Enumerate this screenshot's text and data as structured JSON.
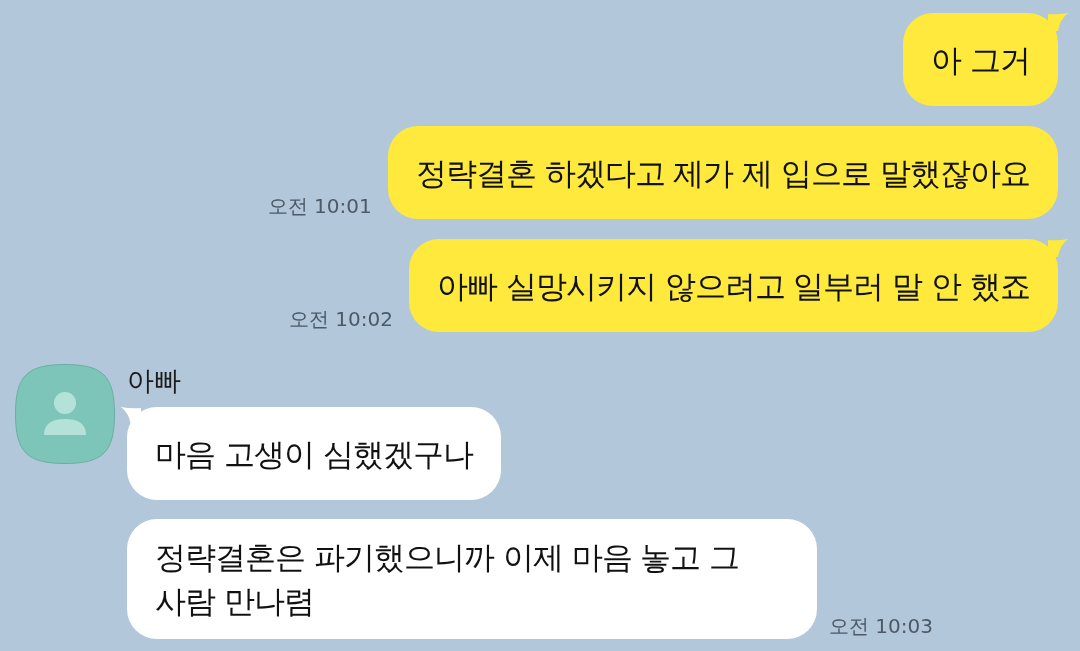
{
  "chat": [
    {
      "kind": "sent",
      "messages": [
        {
          "text": "아 그거",
          "tail": true
        },
        {
          "text": "정략결혼 하겠다고 제가 제 입으로 말했잖아요",
          "tail": false,
          "time": "오전 10:01"
        },
        {
          "text": "아빠 실망시키지 않으려고 일부러 말 안 했죠",
          "tail": true,
          "time": "오전 10:02"
        }
      ]
    },
    {
      "kind": "received",
      "sender": "아빠",
      "messages": [
        {
          "text": "마음 고생이 심했겠구나",
          "tail": true
        },
        {
          "text": "정략결혼은 파기했으니까 이제 마음 놓고 그 사람 만나렴",
          "tail": false,
          "time": "오전 10:03"
        }
      ]
    }
  ]
}
